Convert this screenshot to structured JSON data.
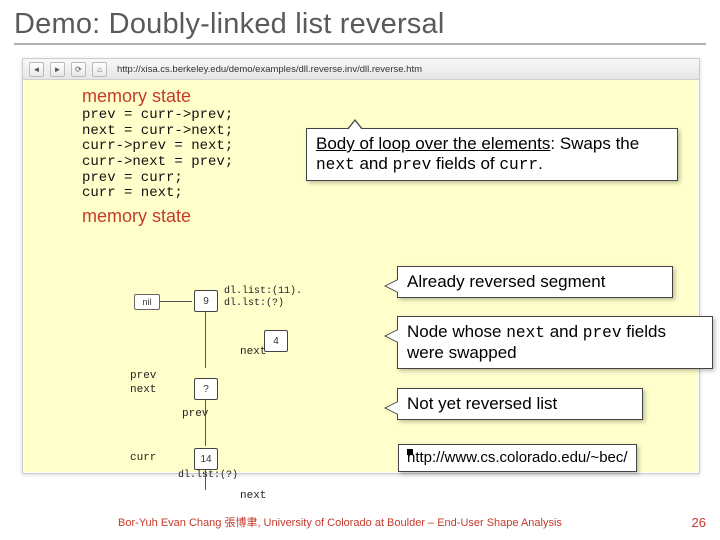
{
  "title": "Demo: Doubly-linked list reversal",
  "browser_url": "http://xisa.cs.berkeley.edu/demo/examples/dll.reverse.inv/dll.reverse.htm",
  "mem_heading1": "memory state",
  "mem_heading2": "memory state",
  "code_lines": [
    "prev = curr->prev;",
    "next = curr->next;",
    "curr->prev = next;",
    "curr->next = prev;",
    "prev = curr;",
    "curr = next;"
  ],
  "callouts": {
    "body": {
      "title_underlined": "Body of loop over the elements",
      "rest1": ": Swaps the ",
      "next": "next",
      "rest2": " and ",
      "prev": "prev",
      "rest3": " fields of ",
      "curr": "curr",
      "rest4": "."
    },
    "already_reversed": "Already reversed segment",
    "swapped1": "Node whose ",
    "swapped_next": "next",
    "swapped2": " and ",
    "swapped_prev": "prev",
    "swapped3": " fields were swapped",
    "not_yet": "Not yet reversed list",
    "url_callout": "http://www.cs.colorado.edu/~bec/"
  },
  "diagram": {
    "node9": "9",
    "node4": "4",
    "nodeQ": "?",
    "node14": "14",
    "nil": "nil",
    "prev_lbl": "prev",
    "next_lbl": "next",
    "curr_lbl": "curr",
    "dl9": "dl.list:(11).",
    "dl9b": "dl.lst:(?)",
    "dl14": "dl.lst:(?)"
  },
  "attribution": "Bor-Yuh Evan Chang 張博聿, University of Colorado at Boulder – End-User Shape Analysis",
  "page_number": "26"
}
